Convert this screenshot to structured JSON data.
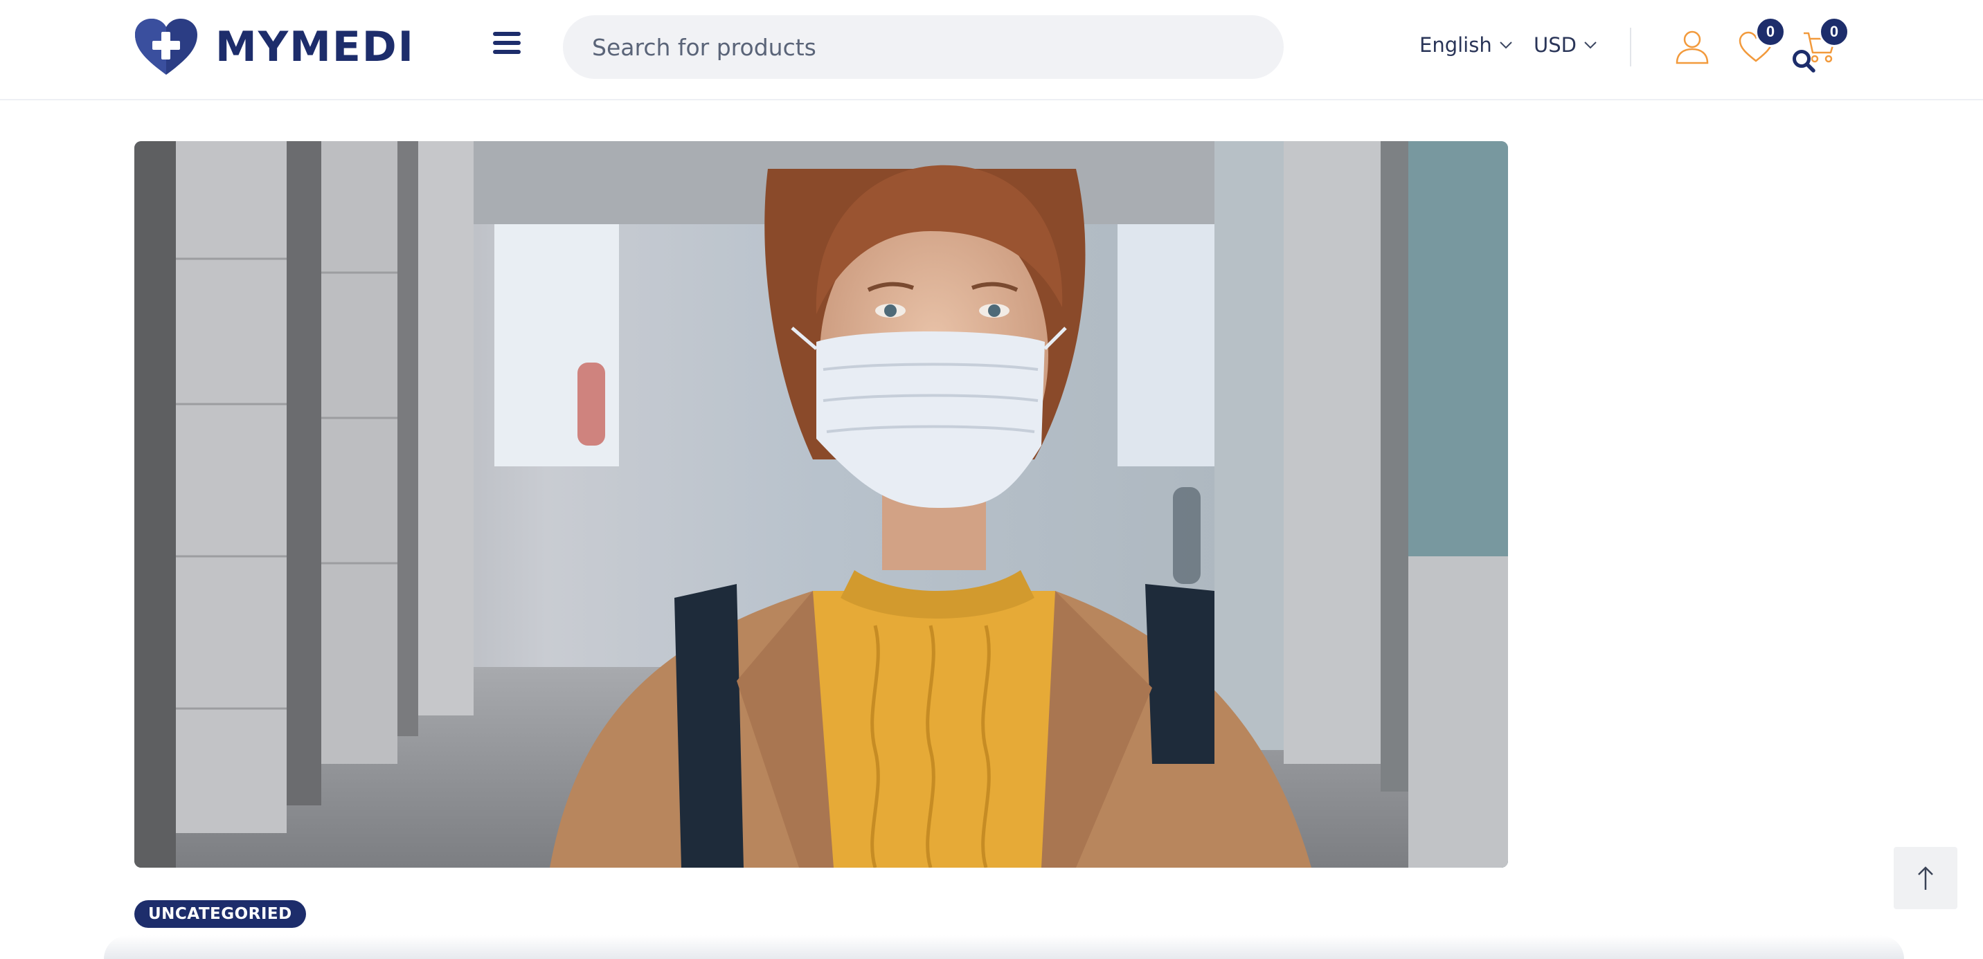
{
  "header": {
    "logo_text": "MYMEDI",
    "search": {
      "placeholder": "Search for products",
      "value": ""
    },
    "language": "English",
    "currency": "USD",
    "wishlist_count": "0",
    "cart_count": "0"
  },
  "post": {
    "category": "UNCATEGORIED"
  },
  "colors": {
    "brand_navy": "#1d2d6b",
    "accent_orange": "#f29a3c"
  },
  "icons": [
    "heart-cross-logo-icon",
    "hamburger-menu-icon",
    "search-icon",
    "chevron-down-icon",
    "user-icon",
    "heart-icon",
    "cart-icon",
    "arrow-up-icon"
  ]
}
